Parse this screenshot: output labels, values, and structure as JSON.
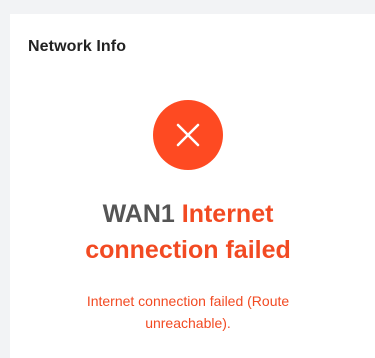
{
  "card": {
    "title": "Network Info"
  },
  "status": {
    "icon": "close-icon",
    "icon_color": "#fe4a22",
    "wan_label": "WAN1",
    "headline_line1": "Internet",
    "headline_line2": "connection failed",
    "detail_line1": "Internet connection failed (Route",
    "detail_line2": "unreachable)."
  },
  "colors": {
    "error": "#f24a22",
    "wan_text": "#555555",
    "title_text": "#222222"
  }
}
